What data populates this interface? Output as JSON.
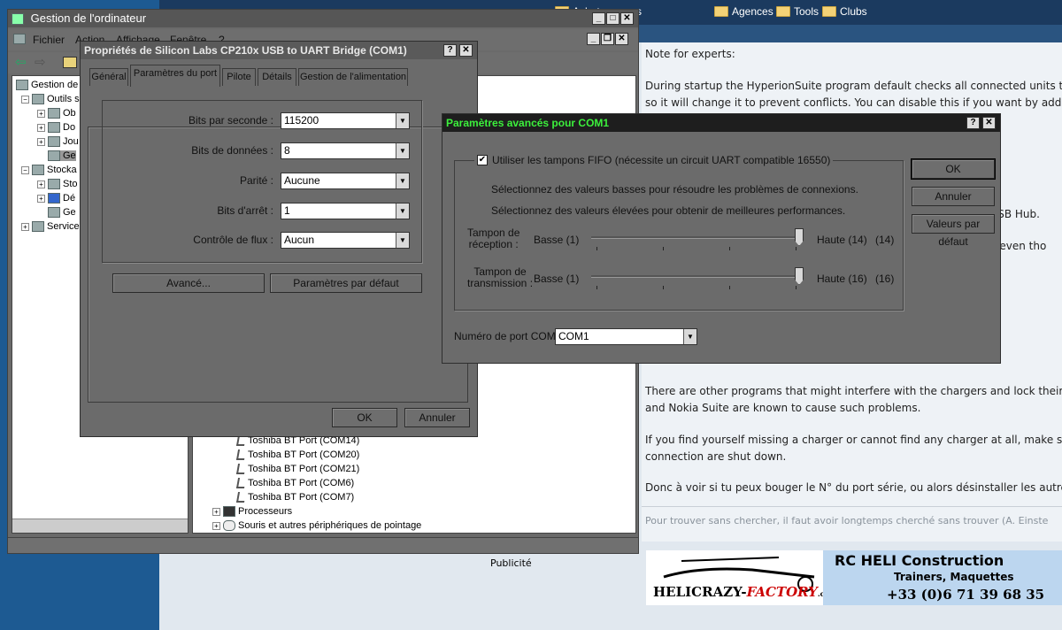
{
  "bookmarks": [
    {
      "label": "rs",
      "partial": true
    },
    {
      "label": "Achats"
    },
    {
      "label": "Agences"
    },
    {
      "label": "Tools"
    },
    {
      "label": "Clubs"
    }
  ],
  "forum": {
    "paragraphs": [
      "Note for experts:",
      "During startup the HyperionSuite program default checks all connected units to c",
      "so it will change it to prevent conflicts. You can disable this if you want by addin",
      "d USB Hub.",
      "ers even tho",
      "There are other programs that might interfere with the chargers and lock their C",
      "and Nokia Suite are known to cause such problems.",
      "If you find yourself missing a charger or cannot find any charger at all, make sur",
      "connection are shut down.",
      "Donc à voir si tu peux bouger le N° du port série, ou alors désinstaller les autres"
    ],
    "signature": "Pour trouver sans chercher, il faut avoir longtemps cherché sans trouver (A. Einste",
    "publicite": "Publicité",
    "ad": {
      "brand_left": "HELICRAZY-",
      "brand_right": "FACTORY",
      "brand_domain": ".com",
      "title": "RC HELI Construction",
      "subtitle": "Trainers, Maquettes",
      "phone": "+33 (0)6 71 39 68 35"
    }
  },
  "compmgmt": {
    "title": "Gestion de l'ordinateur",
    "menu": [
      "Fichier",
      "Action",
      "Affichage",
      "Fenêtre",
      "?"
    ],
    "tree": [
      {
        "label": "Gestion de",
        "level": 0
      },
      {
        "label": "Outils s",
        "level": 1
      },
      {
        "label": "Ob",
        "level": 2
      },
      {
        "label": "Do",
        "level": 2
      },
      {
        "label": "Jou",
        "level": 2
      },
      {
        "label": "Ge",
        "level": 2
      },
      {
        "label": "Stocka",
        "level": 1
      },
      {
        "label": "Sto",
        "level": 2
      },
      {
        "label": "Dé",
        "level": 2
      },
      {
        "label": "Ge",
        "level": 2
      },
      {
        "label": "Service",
        "level": 1
      }
    ],
    "devices": [
      "Toshiba BT Port (COM14)",
      "Toshiba BT Port (COM20)",
      "Toshiba BT Port (COM21)",
      "Toshiba BT Port (COM6)",
      "Toshiba BT Port (COM7)"
    ],
    "categories": [
      "Processeurs",
      "Souris et autres périphériques de pointage"
    ]
  },
  "props": {
    "title": "Propriétés de Silicon Labs CP210x USB to UART Bridge (COM1)",
    "tabs": [
      "Général",
      "Paramètres du port",
      "Pilote",
      "Détails",
      "Gestion de l'alimentation"
    ],
    "active_tab": "Paramètres du port",
    "fields": [
      {
        "label": "Bits par seconde :",
        "value": "115200"
      },
      {
        "label": "Bits de données :",
        "value": "8"
      },
      {
        "label": "Parité :",
        "value": "Aucune"
      },
      {
        "label": "Bits d'arrêt :",
        "value": "1"
      },
      {
        "label": "Contrôle de flux :",
        "value": "Aucun"
      }
    ],
    "advanced_button": "Avancé...",
    "defaults_button": "Paramètres par défaut",
    "ok": "OK",
    "cancel": "Annuler"
  },
  "advanced": {
    "title": "Paramètres avancés pour COM1",
    "fifo_label": "Utiliser les tampons FIFO (nécessite un circuit UART compatible 16550)",
    "fifo_checked": true,
    "hint_low": "Sélectionnez des valeurs basses pour résoudre les problèmes de connexions.",
    "hint_high": "Sélectionnez des valeurs élevées pour obtenir de meilleures performances.",
    "rx": {
      "label1": "Tampon de",
      "label2": "réception :",
      "min_label": "Basse (1)",
      "max_label": "Haute (14)",
      "value": "(14)",
      "level": 1.0
    },
    "tx": {
      "label1": "Tampon de",
      "label2": "transmission :",
      "min_label": "Basse (1)",
      "max_label": "Haute (16)",
      "value": "(16)",
      "level": 1.0
    },
    "com_label": "Numéro de port COM :",
    "com_value": "COM1",
    "ok": "OK",
    "cancel": "Annuler",
    "defaults": "Valeurs par défaut"
  },
  "colors": {
    "desktop": "#1d5a92",
    "advanced_title_bg": "#1e1e1e",
    "advanced_title_fg": "#3cf03c",
    "dialog_bg": "#6b6b6b"
  }
}
